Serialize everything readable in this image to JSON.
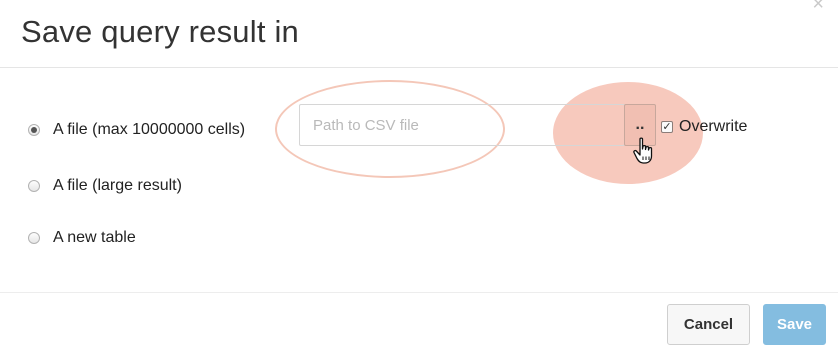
{
  "dialog": {
    "title": "Save query result in",
    "close_icon": "close-icon"
  },
  "options": [
    {
      "label": "A file (max 10000000 cells)",
      "selected": true
    },
    {
      "label": "A file (large result)",
      "selected": false
    },
    {
      "label": "A new table",
      "selected": false
    }
  ],
  "file_path": {
    "value": "",
    "placeholder": "Path to CSV file"
  },
  "browse_button": {
    "label": ".."
  },
  "overwrite": {
    "label": "Overwrite",
    "checked": true
  },
  "footer": {
    "cancel_label": "Cancel",
    "save_label": "Save"
  },
  "colors": {
    "highlight": "#f7c9bd",
    "save_button": "#84bde0"
  }
}
